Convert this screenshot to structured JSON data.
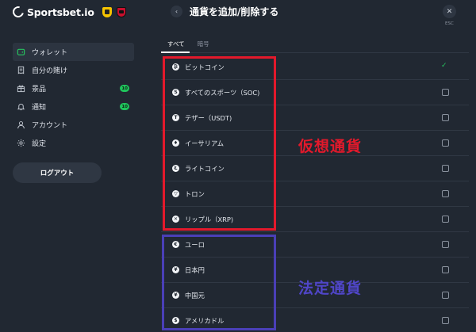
{
  "brand": {
    "name": "Sportsbet.io"
  },
  "sidebar": {
    "items": [
      {
        "label": "ウォレット",
        "icon": "wallet-icon",
        "active": true,
        "badge": ""
      },
      {
        "label": "自分の賭け",
        "icon": "receipt-icon",
        "active": false,
        "badge": ""
      },
      {
        "label": "景品",
        "icon": "gift-icon",
        "active": false,
        "badge": "10"
      },
      {
        "label": "通知",
        "icon": "bell-icon",
        "active": false,
        "badge": "10"
      },
      {
        "label": "アカウント",
        "icon": "user-icon",
        "active": false,
        "badge": ""
      },
      {
        "label": "設定",
        "icon": "gear-icon",
        "active": false,
        "badge": ""
      }
    ],
    "logout_label": "ログアウト"
  },
  "header": {
    "title": "通貨を追加/削除する",
    "back_icon": "chevron-left-icon",
    "close_icon": "close-icon",
    "esc_label": "ESC"
  },
  "tabs": [
    {
      "label": "すべて",
      "active": true
    },
    {
      "label": "暗号",
      "active": false
    }
  ],
  "currencies": [
    {
      "symbol": "₿",
      "name": "ビットコイン",
      "selected": true
    },
    {
      "symbol": "S",
      "name": "すべてのスポーツ（SOC)",
      "selected": false
    },
    {
      "symbol": "T",
      "name": "テザー（USDT)",
      "selected": false
    },
    {
      "symbol": "♦",
      "name": "イーサリアム",
      "selected": false
    },
    {
      "symbol": "Ł",
      "name": "ライトコイン",
      "selected": false
    },
    {
      "symbol": "▽",
      "name": "トロン",
      "selected": false
    },
    {
      "symbol": "✕",
      "name": "リップル（XRP)",
      "selected": false
    },
    {
      "symbol": "€",
      "name": "ユーロ",
      "selected": false
    },
    {
      "symbol": "¥",
      "name": "日本円",
      "selected": false
    },
    {
      "symbol": "¥",
      "name": "中国元",
      "selected": false
    },
    {
      "symbol": "$",
      "name": "アメリカドル",
      "selected": false
    }
  ],
  "annotations": {
    "crypto_label": "仮想通貨",
    "fiat_label": "法定通貨",
    "crypto_color": "#e3192b",
    "fiat_color": "#4a3fb7"
  },
  "colors": {
    "background": "#212832",
    "accent_green": "#27c25f"
  }
}
